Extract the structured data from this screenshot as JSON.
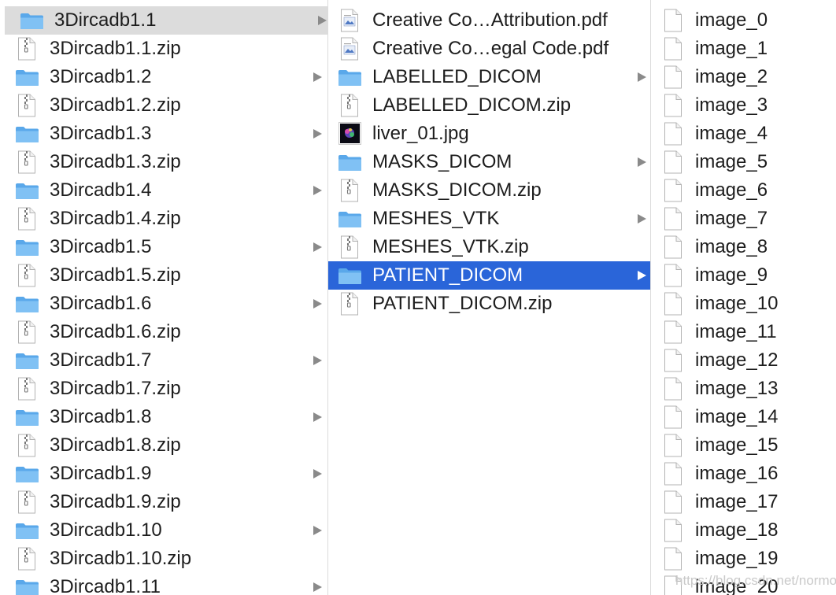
{
  "columns": [
    {
      "items": [
        {
          "label": "3Dircadb1.1",
          "type": "folder",
          "has_children": true,
          "state": "selected-inactive"
        },
        {
          "label": "3Dircadb1.1.zip",
          "type": "zip"
        },
        {
          "label": "3Dircadb1.2",
          "type": "folder",
          "has_children": true
        },
        {
          "label": "3Dircadb1.2.zip",
          "type": "zip"
        },
        {
          "label": "3Dircadb1.3",
          "type": "folder",
          "has_children": true
        },
        {
          "label": "3Dircadb1.3.zip",
          "type": "zip"
        },
        {
          "label": "3Dircadb1.4",
          "type": "folder",
          "has_children": true
        },
        {
          "label": "3Dircadb1.4.zip",
          "type": "zip"
        },
        {
          "label": "3Dircadb1.5",
          "type": "folder",
          "has_children": true
        },
        {
          "label": "3Dircadb1.5.zip",
          "type": "zip"
        },
        {
          "label": "3Dircadb1.6",
          "type": "folder",
          "has_children": true
        },
        {
          "label": "3Dircadb1.6.zip",
          "type": "zip"
        },
        {
          "label": "3Dircadb1.7",
          "type": "folder",
          "has_children": true
        },
        {
          "label": "3Dircadb1.7.zip",
          "type": "zip"
        },
        {
          "label": "3Dircadb1.8",
          "type": "folder",
          "has_children": true
        },
        {
          "label": "3Dircadb1.8.zip",
          "type": "zip"
        },
        {
          "label": "3Dircadb1.9",
          "type": "folder",
          "has_children": true
        },
        {
          "label": "3Dircadb1.9.zip",
          "type": "zip"
        },
        {
          "label": "3Dircadb1.10",
          "type": "folder",
          "has_children": true
        },
        {
          "label": "3Dircadb1.10.zip",
          "type": "zip"
        },
        {
          "label": "3Dircadb1.11",
          "type": "folder",
          "has_children": true
        }
      ]
    },
    {
      "items": [
        {
          "label": "Creative Co…Attribution.pdf",
          "type": "pdf"
        },
        {
          "label": "Creative Co…egal Code.pdf",
          "type": "pdf"
        },
        {
          "label": "LABELLED_DICOM",
          "type": "folder",
          "has_children": true
        },
        {
          "label": "LABELLED_DICOM.zip",
          "type": "zip"
        },
        {
          "label": "liver_01.jpg",
          "type": "jpg"
        },
        {
          "label": "MASKS_DICOM",
          "type": "folder",
          "has_children": true
        },
        {
          "label": "MASKS_DICOM.zip",
          "type": "zip"
        },
        {
          "label": "MESHES_VTK",
          "type": "folder",
          "has_children": true
        },
        {
          "label": "MESHES_VTK.zip",
          "type": "zip"
        },
        {
          "label": "PATIENT_DICOM",
          "type": "folder",
          "has_children": true,
          "state": "selected-active"
        },
        {
          "label": "PATIENT_DICOM.zip",
          "type": "zip"
        }
      ]
    },
    {
      "items": [
        {
          "label": "image_0",
          "type": "file"
        },
        {
          "label": "image_1",
          "type": "file"
        },
        {
          "label": "image_2",
          "type": "file"
        },
        {
          "label": "image_3",
          "type": "file"
        },
        {
          "label": "image_4",
          "type": "file"
        },
        {
          "label": "image_5",
          "type": "file"
        },
        {
          "label": "image_6",
          "type": "file"
        },
        {
          "label": "image_7",
          "type": "file"
        },
        {
          "label": "image_8",
          "type": "file"
        },
        {
          "label": "image_9",
          "type": "file"
        },
        {
          "label": "image_10",
          "type": "file"
        },
        {
          "label": "image_11",
          "type": "file"
        },
        {
          "label": "image_12",
          "type": "file"
        },
        {
          "label": "image_13",
          "type": "file"
        },
        {
          "label": "image_14",
          "type": "file"
        },
        {
          "label": "image_15",
          "type": "file"
        },
        {
          "label": "image_16",
          "type": "file"
        },
        {
          "label": "image_17",
          "type": "file"
        },
        {
          "label": "image_18",
          "type": "file"
        },
        {
          "label": "image_19",
          "type": "file"
        },
        {
          "label": "image_20",
          "type": "file"
        }
      ]
    }
  ],
  "watermark": "https://blog.csdn.net/normol",
  "colors": {
    "selection_active": "#2a65d9",
    "selection_inactive": "#dcdcdc",
    "folder": "#7bbdf0",
    "chevron": "#8a8a8a"
  }
}
